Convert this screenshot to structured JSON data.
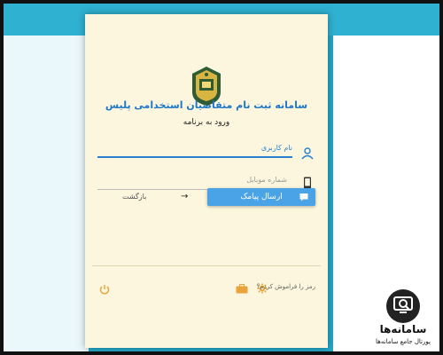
{
  "app": {
    "title": "سامانه ثبت نام متقاضیان استخدامی پلیس",
    "subtitle": "ورود به برنامه"
  },
  "form": {
    "username_label": "نام کاربری",
    "mobile_placeholder": "شماره موبایل",
    "send_button": "ارسال پیامک",
    "back_label": "بازگشت",
    "forgot_label": "رمز را فراموش کردم؟"
  },
  "watermark": {
    "title": "سامانه‌ها",
    "subtitle": "پورتال جامع سامانه‌ها"
  },
  "colors": {
    "accent": "#2a7fd0",
    "button": "#4aa3e6",
    "card_bg": "#fbf6dd",
    "frame_bg": "#25a7c8"
  },
  "icons": {
    "emblem": "police-emblem",
    "user": "user-icon",
    "phone": "phone-icon",
    "send": "message-icon",
    "back": "arrow-right-icon",
    "power": "power-icon",
    "gear": "gear-icon",
    "briefcase": "briefcase-icon"
  }
}
